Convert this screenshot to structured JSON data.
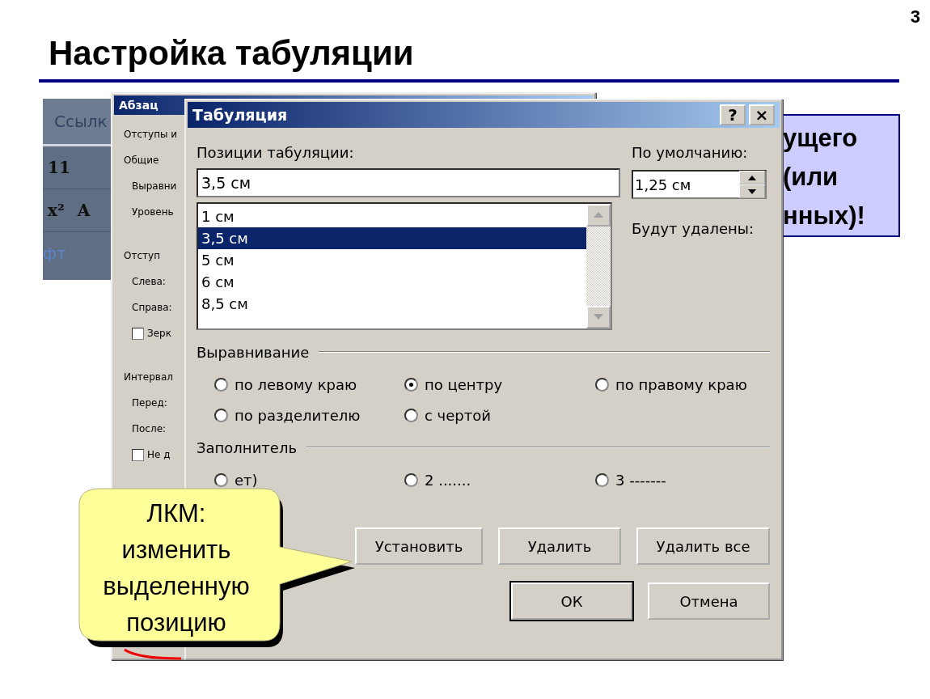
{
  "slide": {
    "number": "3",
    "title": "Настройка табуляции"
  },
  "ribbon": {
    "tab": "Ссылк",
    "font_size": "11",
    "superscript": "x²",
    "letter": "A",
    "group": "фт"
  },
  "paragraph_dialog": {
    "title": "Абзац",
    "labels": [
      {
        "kind": "tab",
        "text": "Отступы и"
      },
      {
        "kind": "group",
        "text": "Общие"
      },
      {
        "kind": "label",
        "text": "Выравни"
      },
      {
        "kind": "label",
        "text": "Уровень"
      },
      {
        "kind": "group",
        "text": "Отступ"
      },
      {
        "kind": "label",
        "text": "Слева:"
      },
      {
        "kind": "label",
        "text": "Справа:"
      },
      {
        "kind": "checkbox",
        "text": "Зерк",
        "checked": false
      },
      {
        "kind": "group",
        "text": "Интервал"
      },
      {
        "kind": "label",
        "text": "Перед:"
      },
      {
        "kind": "label",
        "text": "После:"
      },
      {
        "kind": "checkbox",
        "text": "Не д",
        "checked": false
      }
    ]
  },
  "note": {
    "lines": [
      "ущего",
      "(или",
      "нных)!"
    ]
  },
  "tab_dialog": {
    "title": "Табуляция",
    "help": "?",
    "close": "×",
    "positions_label": "Позиции табуляции:",
    "position_value": "3,5 см",
    "positions": [
      {
        "text": "1 см",
        "selected": false
      },
      {
        "text": "3,5 см",
        "selected": true
      },
      {
        "text": "5 см",
        "selected": false
      },
      {
        "text": "6 см",
        "selected": false
      },
      {
        "text": "8,5 см",
        "selected": false
      }
    ],
    "default_label": "По умолчанию:",
    "default_value": "1,25 см",
    "to_delete_label": "Будут удалены:",
    "alignment": {
      "title": "Выравнивание",
      "options": [
        {
          "text": "по левому краю",
          "selected": false
        },
        {
          "text": "по центру",
          "selected": true
        },
        {
          "text": "по правому краю",
          "selected": false
        },
        {
          "text": "по разделителю",
          "selected": false
        },
        {
          "text": "с чертой",
          "selected": false
        }
      ]
    },
    "leader": {
      "title": "Заполнитель",
      "options": [
        {
          "text": "ет)",
          "selected": false
        },
        {
          "text": "2 .......",
          "selected": false
        },
        {
          "text": "3 -------",
          "selected": false
        }
      ]
    },
    "buttons": [
      {
        "text": "Установить",
        "default": false
      },
      {
        "text": "Удалить",
        "default": false
      },
      {
        "text": "Удалить все",
        "default": false
      }
    ],
    "footer_buttons": [
      {
        "text": "ОК",
        "default": true
      },
      {
        "text": "Отмена",
        "default": false
      }
    ]
  },
  "callout": {
    "lines": [
      "ЛКМ:",
      "изменить",
      "выделенную",
      "позицию"
    ]
  }
}
